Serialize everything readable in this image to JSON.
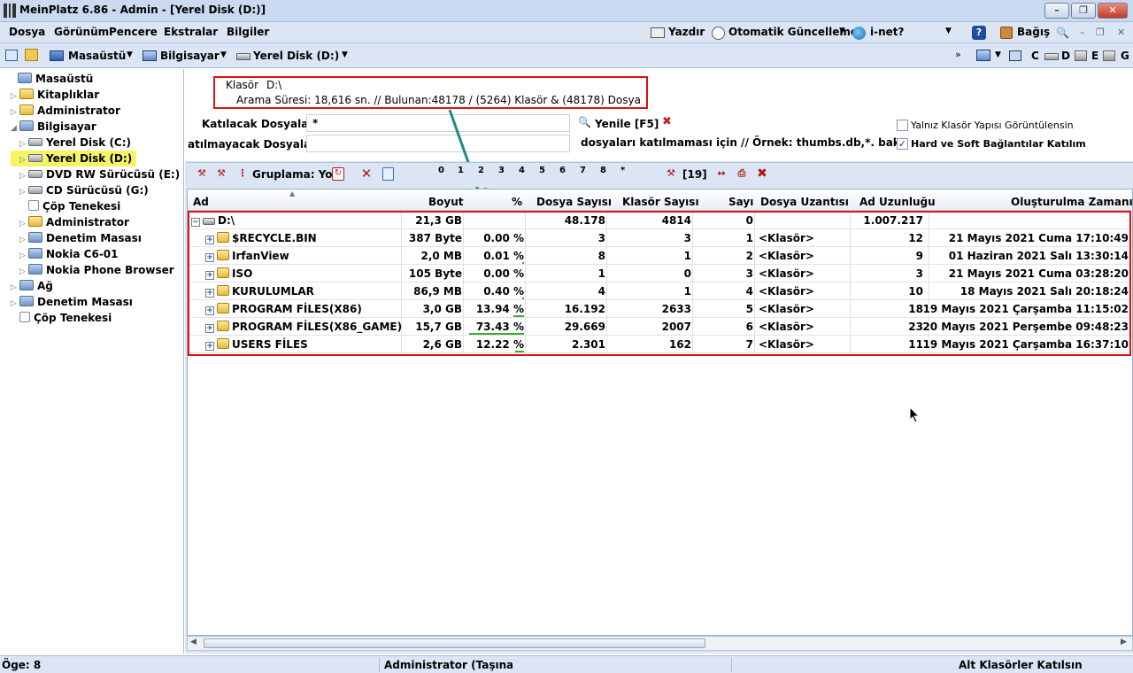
{
  "window": {
    "title": "MeinPlatz 6.86 - Admin - [Yerel Disk (D:)]"
  },
  "menu": {
    "items": [
      "Dosya",
      "Görünüm",
      "Pencere",
      "Ekstralar",
      "Bilgiler"
    ],
    "print": "Yazdır",
    "auto_update": "Otomatik Güncelleme",
    "inet": "i-net?",
    "donate": "Bağış"
  },
  "nav": {
    "desktop": "Masaüstü",
    "computer": "Bilgisayar",
    "disk": "Yerel Disk (D:)",
    "drive_labels": [
      "C",
      "D",
      "E",
      "G"
    ]
  },
  "tree": {
    "items": [
      {
        "label": "Masaüstü",
        "level": 0,
        "icon": "desktop-icon"
      },
      {
        "label": "Kitaplıklar",
        "level": 1,
        "icon": "folder-icon"
      },
      {
        "label": "Administrator",
        "level": 1,
        "icon": "folder-icon"
      },
      {
        "label": "Bilgisayar",
        "level": 1,
        "icon": "computer-icon"
      },
      {
        "label": "Yerel Disk (C:)",
        "level": 2,
        "icon": "drive-icon"
      },
      {
        "label": "Yerel Disk (D:)",
        "level": 2,
        "icon": "drive-icon",
        "selected": true
      },
      {
        "label": "DVD RW Sürücüsü (E:)",
        "level": 2,
        "icon": "dvd-drive-icon"
      },
      {
        "label": "CD Sürücüsü (G:)",
        "level": 2,
        "icon": "cd-drive-icon"
      },
      {
        "label": "Çöp Tenekesi",
        "level": 2,
        "icon": "recycle-bin-icon"
      },
      {
        "label": "Administrator",
        "level": 2,
        "icon": "folder-icon"
      },
      {
        "label": "Denetim Masası",
        "level": 2,
        "icon": "control-panel-icon"
      },
      {
        "label": "Nokia C6-01",
        "level": 2,
        "icon": "phone-icon"
      },
      {
        "label": "Nokia Phone Browser",
        "level": 2,
        "icon": "phone-icon"
      },
      {
        "label": "Ağ",
        "level": 1,
        "icon": "network-icon"
      },
      {
        "label": "Denetim Masası",
        "level": 1,
        "icon": "control-panel-icon"
      },
      {
        "label": "Çöp Tenekesi",
        "level": 1,
        "icon": "recycle-bin-icon"
      }
    ]
  },
  "search": {
    "folder_label": "Klasör",
    "folder_value": "D:\\",
    "result": "Arama Süresi: 18,616 sn. //  Bulunan:48178 / (5264) Klasör & (48178) Dosya",
    "include_label": "Katılacak Dosyalar",
    "include_value": "*",
    "refresh": "Yenile [F5]",
    "exclude_label": "atılmayacak Dosyalar",
    "exclude_value": "",
    "exclude_hint": "dosyaları katılmaması için // Örnek: thumbs.db,*. bak",
    "opt_folder_only": "Yalnız Klasör Yapısı Görüntülensin",
    "opt_folder_only_checked": false,
    "opt_links": "Hard ve Soft Bağlantılar Katılım",
    "opt_links_checked": true
  },
  "toolbar3": {
    "grouping": "Gruplama: Yol",
    "levels": [
      "0",
      "1",
      "2",
      "3",
      "4",
      "5",
      "6",
      "7",
      "8",
      "*"
    ],
    "count": "[19]"
  },
  "table": {
    "columns": [
      "Ad",
      "Boyut",
      "%",
      "Dosya Sayısı",
      "Klasör Sayısı",
      "Sayı",
      "Dosya Uzantısı",
      "Ad Uzunluğu",
      "Oluşturulma Zamanı"
    ],
    "root": {
      "name": "D:\\",
      "size": "21,3 GB",
      "pct": "",
      "files": "48.178",
      "folders": "4814",
      "num": "0",
      "ext": "",
      "namelen": "1.007.217",
      "created": ""
    },
    "rows": [
      {
        "name": "$RECYCLE.BIN",
        "size": "387 Byte",
        "pct": "0.00 %",
        "files": "3",
        "folders": "3",
        "num": "1",
        "ext": "<Klasör>",
        "namelen": "12",
        "created": "21 Mayıs 2021 Cuma 17:10:49",
        "bar": 0.0
      },
      {
        "name": "IrfanView",
        "size": "2,0 MB",
        "pct": "0.01 %",
        "files": "8",
        "folders": "1",
        "num": "2",
        "ext": "<Klasör>",
        "namelen": "9",
        "created": "01 Haziran 2021 Salı 13:30:14",
        "bar": 0.0001
      },
      {
        "name": "ISO",
        "size": "105 Byte",
        "pct": "0.00 %",
        "files": "1",
        "folders": "0",
        "num": "3",
        "ext": "<Klasör>",
        "namelen": "3",
        "created": "21 Mayıs 2021 Cuma 03:28:20",
        "bar": 0.0
      },
      {
        "name": "KURULUMLAR",
        "size": "86,9 MB",
        "pct": "0.40 %",
        "files": "4",
        "folders": "1",
        "num": "4",
        "ext": "<Klasör>",
        "namelen": "10",
        "created": "18 Mayıs 2021 Salı 20:18:24",
        "bar": 0.004
      },
      {
        "name": "PROGRAM FİLES(X86)",
        "size": "3,0 GB",
        "pct": "13.94 %",
        "files": "16.192",
        "folders": "2633",
        "num": "5",
        "ext": "<Klasör>",
        "namelen": "18",
        "created": "19 Mayıs 2021 Çarşamba 11:15:02",
        "bar": 0.1394
      },
      {
        "name": "PROGRAM FİLES(X86_GAME)",
        "size": "15,7 GB",
        "pct": "73.43 %",
        "files": "29.669",
        "folders": "2007",
        "num": "6",
        "ext": "<Klasör>",
        "namelen": "23",
        "created": "20 Mayıs 2021 Perşembe 09:48:23",
        "bar": 0.7343
      },
      {
        "name": "USERS FİLES",
        "size": "2,6 GB",
        "pct": "12.22 %",
        "files": "2.301",
        "folders": "162",
        "num": "7",
        "ext": "<Klasör>",
        "namelen": "11",
        "created": "19 Mayıs 2021 Çarşamba 16:37:10",
        "bar": 0.1222
      }
    ]
  },
  "status": {
    "items": "Öge: 8",
    "user": "Administrator (Taşınabilir",
    "mode": "Alt Klasörler Katılsın"
  },
  "colors": {
    "highlight_border": "#dd1111",
    "arrow": "#1e8a84",
    "selected_tree": "#f4f466",
    "bar": "#3aaa35"
  }
}
